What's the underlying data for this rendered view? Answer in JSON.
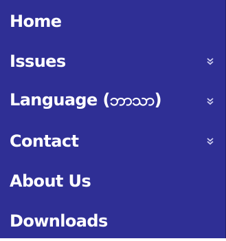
{
  "nav": {
    "items": [
      {
        "label": "Home",
        "has_submenu": false
      },
      {
        "label": "Issues",
        "has_submenu": true,
        "icon": "double-chevron-down-icon"
      },
      {
        "label": "Language (ဘာသာ)",
        "has_submenu": true,
        "icon": "double-chevron-down-icon"
      },
      {
        "label": "Contact",
        "has_submenu": true,
        "icon": "double-chevron-down-icon"
      },
      {
        "label": "About Us",
        "has_submenu": false
      },
      {
        "label": "Downloads",
        "has_submenu": false
      }
    ]
  },
  "colors": {
    "background": "#2f2f95",
    "text": "#ffffff",
    "chevron": "#d0d0f0"
  }
}
